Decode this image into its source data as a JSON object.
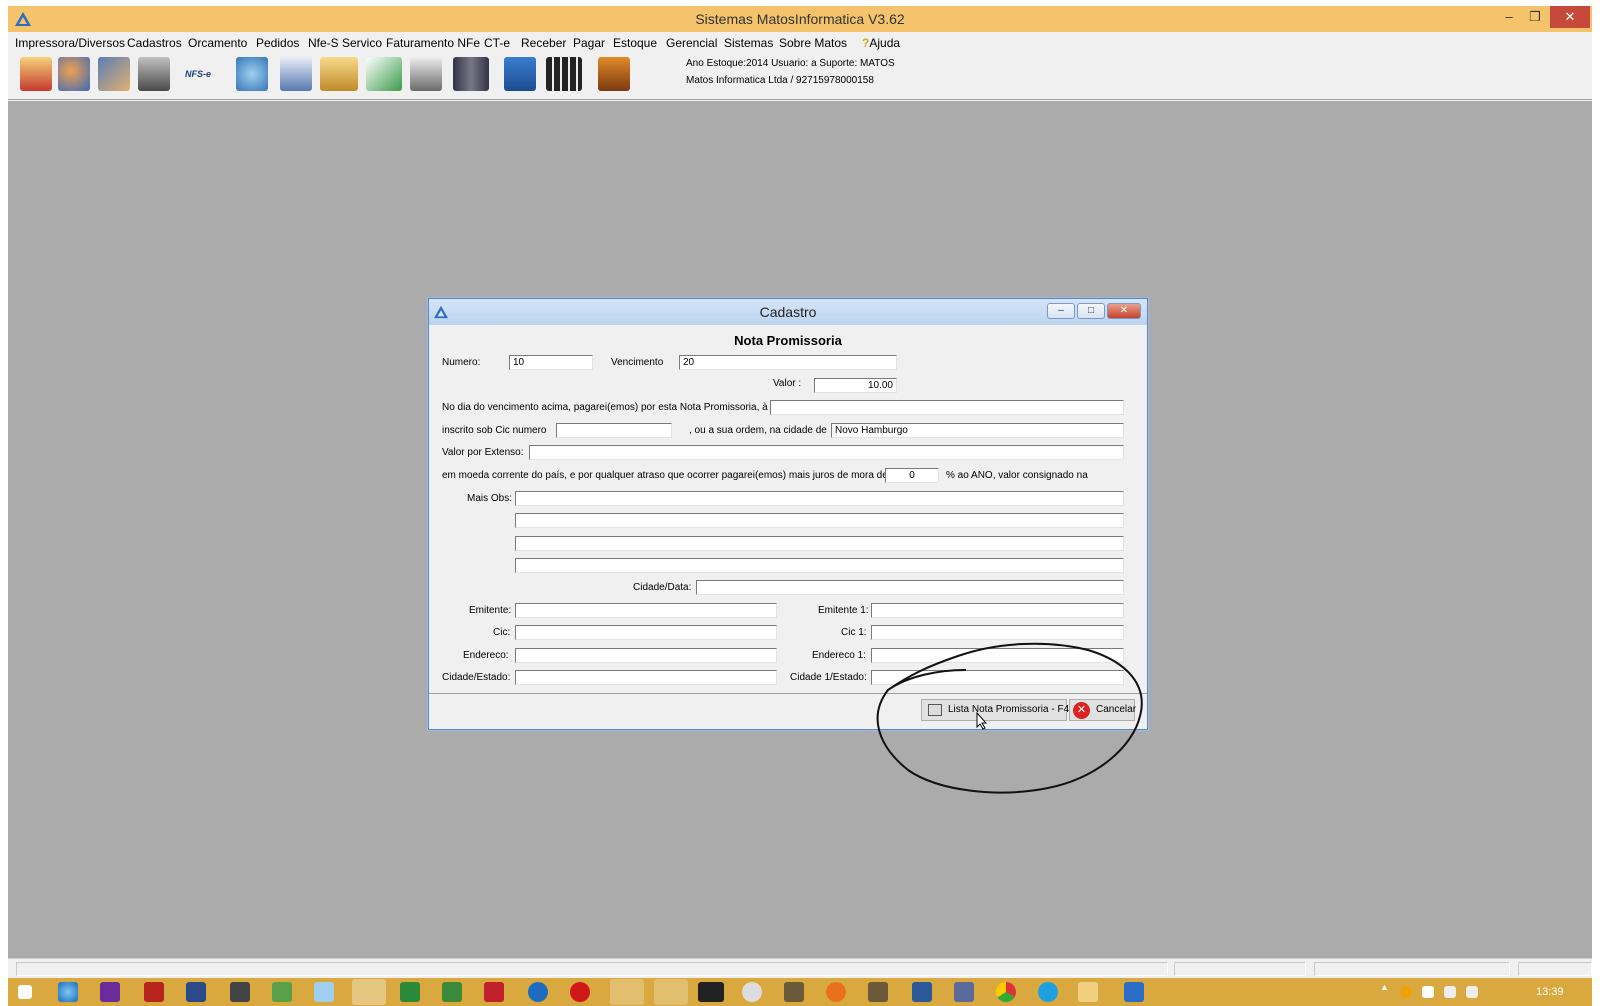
{
  "window": {
    "title": "Sistemas MatosInformatica V3.62",
    "minimize": "–",
    "restore": "❐",
    "close": "✕"
  },
  "menu": [
    "Impressora/Diversos",
    "Cadastros",
    "Orcamento",
    "Pedidos",
    "Nfe-S Servico",
    "Faturamento NFe",
    "CT-e",
    "Receber",
    "Pagar",
    "Estoque",
    "Gerencial",
    "Sistemas",
    "Sobre Matos",
    "Ajuda"
  ],
  "toolbar": {
    "icons": [
      "gift-icon",
      "users-icon",
      "truck-icon",
      "printer-icon",
      "nfse-icon",
      "phone-icon",
      "document-edit-icon",
      "boxes-icon",
      "mail-icon",
      "checklist-icon",
      "tools-icon",
      "save-icon",
      "calculator-icon",
      "exit-icon"
    ],
    "nfse_text": "NFS-e",
    "info_line1": "Ano Estoque:2014 Usuario: a Suporte: MATOS",
    "info_line2": "Matos Informatica Ltda / 92715978000158"
  },
  "dialog": {
    "title": "Cadastro",
    "form_title": "Nota Promissoria",
    "numero_label": "Numero:",
    "numero_value": "10",
    "vencimento_label": "Vencimento",
    "vencimento_value": "20",
    "valor_label": "Valor :",
    "valor_value": "10.00",
    "sentence1": "No dia do vencimento acima, pagarei(emos) por esta Nota Promissoria, à",
    "beneficiario_value": "",
    "cic_label": "inscrito sob Cic numero",
    "cic_value": "",
    "ordem_text": ", ou a sua ordem, na cidade de",
    "cidade_value": "Novo Hamburgo",
    "extenso_label": "Valor por Extenso:",
    "extenso_value": "",
    "moeda_text": "em moeda corrente do país, e por qualquer atraso que ocorrer pagarei(emos) mais juros de mora de",
    "juros_value": "0",
    "ano_text": "% ao ANO, valor consignado na",
    "obs_label": "Mais Obs:",
    "cidade_data_label": "Cidade/Data:",
    "emitente_label": "Emitente:",
    "emitente1_label": "Emitente 1:",
    "cic_field_label": "Cic:",
    "cic1_label": "Cic 1:",
    "endereco_label": "Endereco:",
    "endereco1_label": "Endereco 1:",
    "cidade_estado_label": "Cidade/Estado:",
    "cidade1_estado_label": "Cidade 1/Estado:",
    "lista_button": "Lista Nota Promissoria - F4",
    "cancel_button": "Cancelar"
  },
  "taskbar": {
    "clock": "13:39"
  }
}
